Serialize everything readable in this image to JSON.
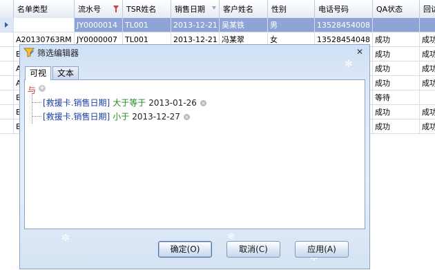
{
  "grid": {
    "columns": [
      "名单类型",
      "流水号",
      "TSR姓名",
      "销售日期",
      "客户姓名",
      "性别",
      "电话号码",
      "QA状态",
      "回访"
    ],
    "rows": [
      [
        "",
        "JY0000014",
        "TL001",
        "2013-12-21",
        "吴某铁",
        "男",
        "13528454008",
        "",
        ""
      ],
      [
        "A20130763RM",
        "JY0000007",
        "TL001",
        "2013-12-21",
        "冯某翠",
        "女",
        "13528454048",
        "成功",
        "成功"
      ],
      [
        "B",
        "",
        "",
        "",
        "",
        "",
        "",
        "成功",
        "成功"
      ],
      [
        "A",
        "",
        "",
        "",
        "",
        "",
        "",
        "成功",
        "成功"
      ],
      [
        "A",
        "",
        "",
        "",
        "",
        "",
        "",
        "成功",
        "成功"
      ],
      [
        "B",
        "",
        "",
        "",
        "",
        "",
        "",
        "等待",
        ""
      ],
      [
        "B",
        "",
        "",
        "",
        "",
        "",
        "",
        "成功",
        "成功"
      ],
      [
        "B",
        "",
        "",
        "",
        "",
        "",
        "",
        "成功",
        "成功"
      ]
    ]
  },
  "dialog": {
    "title": "筛选编辑器",
    "tabs": [
      "可视",
      "文本"
    ],
    "group_label": "与",
    "conditions": [
      {
        "field": "[救援卡.销售日期]",
        "operator": "大于等于",
        "value": "2013-01-26"
      },
      {
        "field": "[救援卡.销售日期]",
        "operator": "小于",
        "value": "2013-12-27"
      }
    ],
    "buttons": {
      "ok": "确定(O)",
      "cancel": "取消(C)",
      "apply": "应用(A)"
    }
  },
  "colors": {
    "selected_row": "#8ea4d6",
    "group": "#c0392b",
    "field": "#1a3fa0",
    "operator": "#1e8a1e"
  }
}
